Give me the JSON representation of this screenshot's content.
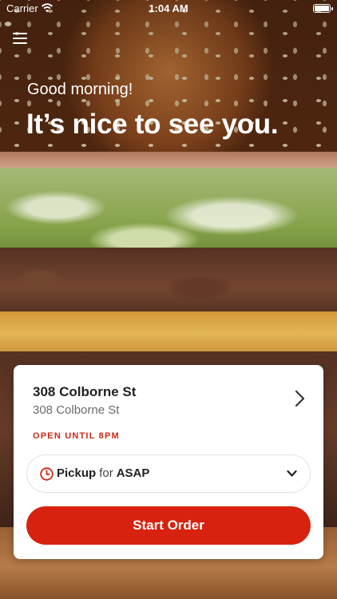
{
  "status_bar": {
    "carrier": "Carrier",
    "time": "1:04 AM",
    "battery_level": 1.0
  },
  "header": {
    "menu_icon": "hamburger-menu-icon",
    "greeting": "Good morning!",
    "headline": "It’s nice to see you."
  },
  "store_card": {
    "name": "308 Colborne St",
    "address": "308 Colborne St",
    "hours": "OPEN UNTIL 8PM",
    "chevron_icon": "chevron-right-icon",
    "pickup": {
      "icon": "clock-icon",
      "mode": "Pickup",
      "for": "for",
      "time": "ASAP",
      "dropdown_icon": "chevron-down-icon"
    },
    "start_label": "Start Order"
  },
  "colors": {
    "accent": "#d6220e",
    "hours_text": "#cc2a17",
    "card_bg": "#ffffff"
  }
}
